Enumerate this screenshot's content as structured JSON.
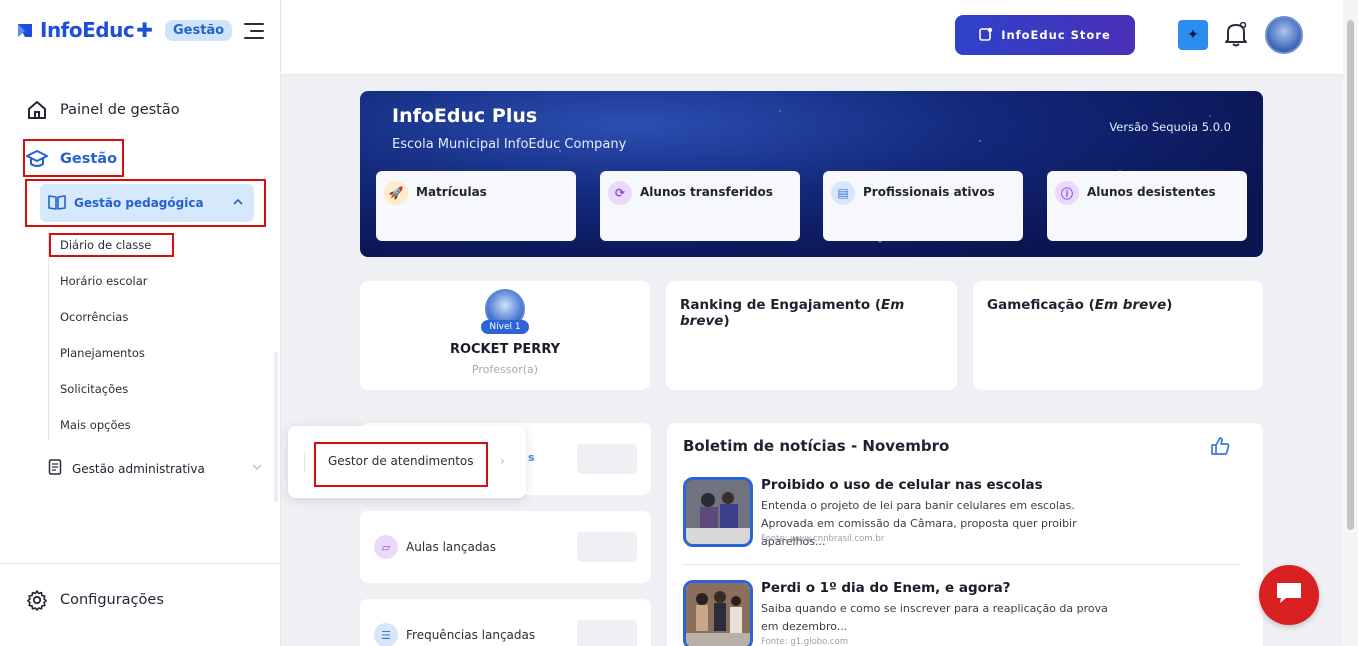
{
  "brand": {
    "name": "InfoEduc",
    "badge": "Gestão"
  },
  "sidebar": {
    "items": [
      {
        "label": "Painel de gestão",
        "icon": "home-icon"
      },
      {
        "label": "Gestão",
        "icon": "graduation-cap-icon"
      }
    ],
    "active_submenu": {
      "label": "Gestão pedagógica",
      "icon": "book-open-icon"
    },
    "sublinks": [
      "Diário de classe",
      "Horário escolar",
      "Ocorrências",
      "Planejamentos",
      "Solicitações",
      "Mais opções"
    ],
    "admin": {
      "label": "Gestão administrativa",
      "icon": "document-icon"
    },
    "settings": {
      "label": "Configurações",
      "icon": "gear-icon"
    }
  },
  "topbar": {
    "store_label": "InfoEduc Store"
  },
  "banner": {
    "title": "InfoEduc Plus",
    "subtitle": "Escola Municipal InfoEduc Company",
    "version": "Versão Sequoia 5.0.0",
    "stats": [
      {
        "label": "Matrículas",
        "icon": "rocket-icon",
        "color": "#f2b53a"
      },
      {
        "label": "Alunos transferidos",
        "icon": "refresh-icon",
        "color": "#8c4cd6"
      },
      {
        "label": "Profissionais ativos",
        "icon": "id-card-icon",
        "color": "#3a7bd5"
      },
      {
        "label": "Alunos desistentes",
        "icon": "info-icon",
        "color": "#8c4cd6"
      }
    ]
  },
  "profile": {
    "level": "Nível 1",
    "name": "ROCKET PERRY",
    "role": "Professor(a)"
  },
  "ranking": {
    "title": "Ranking de Engajamento (",
    "soon": "Em breve",
    "close": ")"
  },
  "gamification": {
    "title": "Gameficação (",
    "soon": "Em breve",
    "close": ")"
  },
  "popup": {
    "item": "Gestor de atendimentos",
    "partial": "s"
  },
  "mini_cards": [
    {
      "label": "Aulas lançadas",
      "icon": "chalkboard-icon"
    },
    {
      "label": "Frequências lançadas",
      "icon": "checklist-icon"
    }
  ],
  "news": {
    "title": "Boletim de notícias - Novembro",
    "items": [
      {
        "headline": "Proibido o uso de celular nas escolas",
        "body": "Entenda o projeto de lei para banir celulares em escolas. Aprovada em comissão da Câmara, proposta quer proibir aparelhos...",
        "source": "Fonte: www.cnnbrasil.com.br"
      },
      {
        "headline": "Perdi o 1º dia do Enem, e agora?",
        "body": "Saiba quando e como se inscrever para a reaplicação da prova em dezembro...",
        "source": "Fonte: g1.globo.com"
      }
    ]
  }
}
